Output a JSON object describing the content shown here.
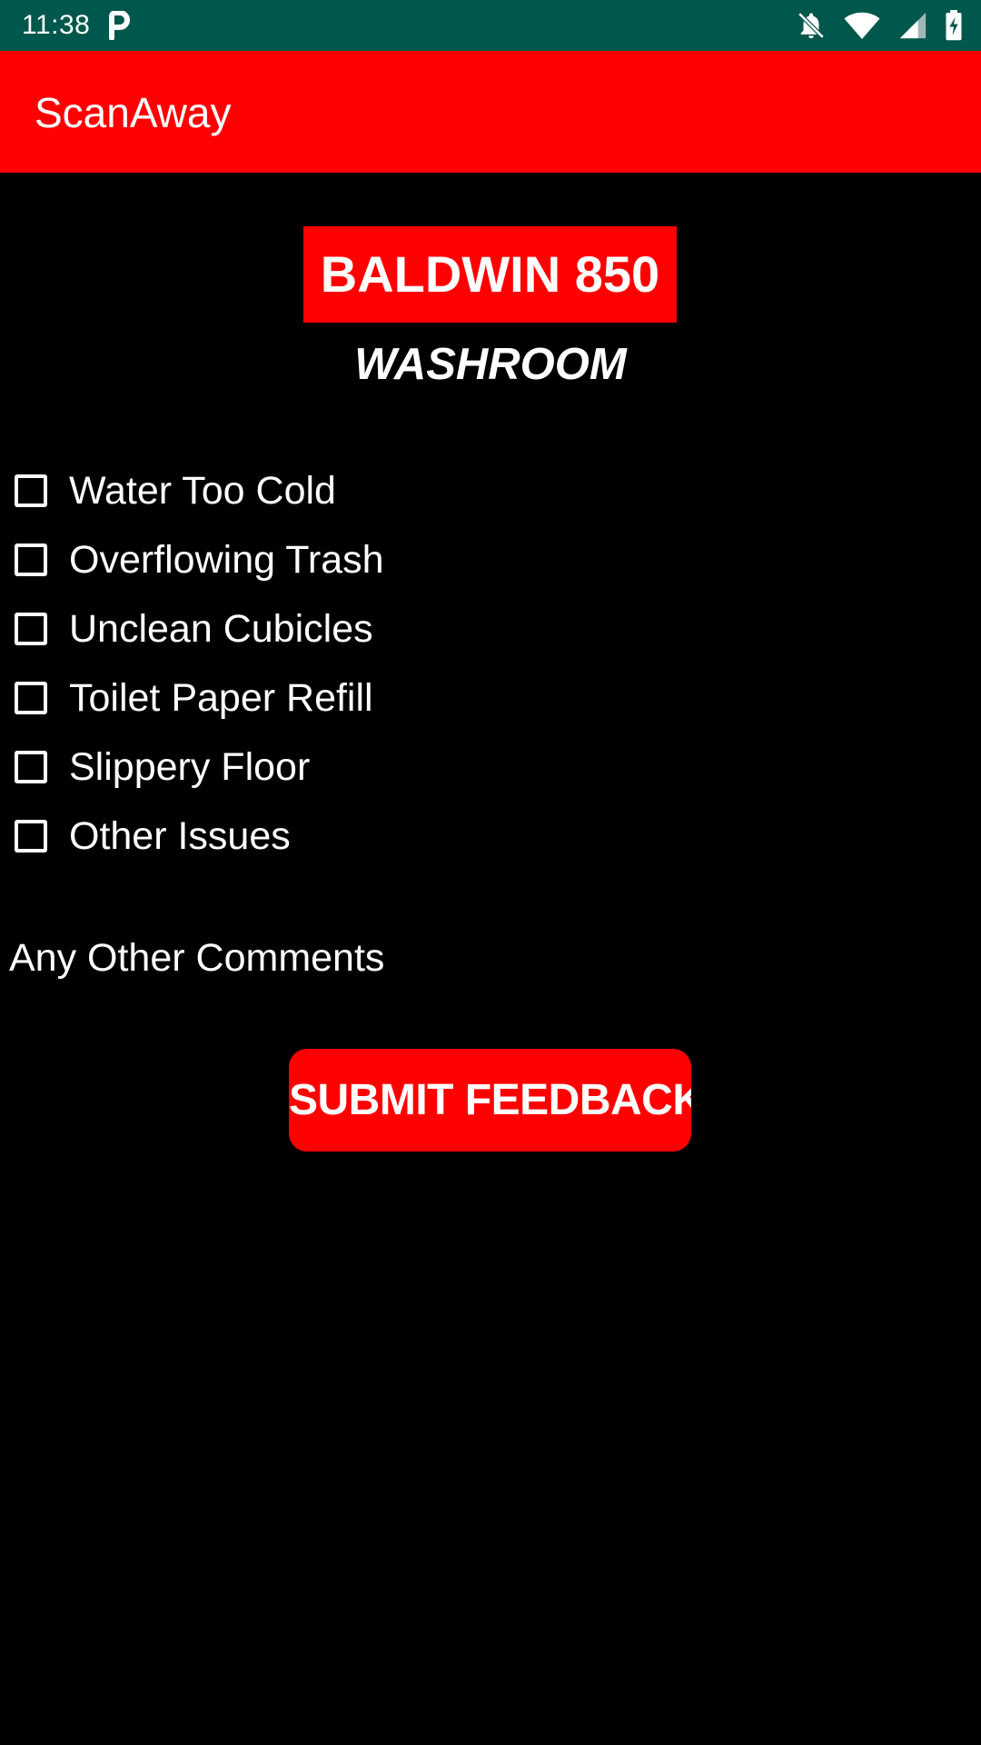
{
  "status_bar": {
    "time": "11:38",
    "background": "#00574B",
    "icons": [
      "parking-p-icon",
      "notifications-off-icon",
      "wifi-icon",
      "cell-signal-icon",
      "battery-charging-icon"
    ]
  },
  "app_bar": {
    "title": "ScanAway",
    "background": "#FF0000"
  },
  "location": {
    "name": "BALDWIN 850",
    "type": "WASHROOM"
  },
  "issues": [
    {
      "label": "Water Too Cold",
      "checked": false
    },
    {
      "label": "Overflowing Trash",
      "checked": false
    },
    {
      "label": "Unclean Cubicles",
      "checked": false
    },
    {
      "label": "Toilet Paper Refill",
      "checked": false
    },
    {
      "label": "Slippery Floor",
      "checked": false
    },
    {
      "label": "Other Issues",
      "checked": false
    }
  ],
  "comments": {
    "placeholder": "Any Other Comments",
    "value": ""
  },
  "submit": {
    "label": "SUBMIT FEEDBACK"
  },
  "colors": {
    "accent": "#FF0000",
    "background": "#000000",
    "text": "#FFFFFF"
  }
}
